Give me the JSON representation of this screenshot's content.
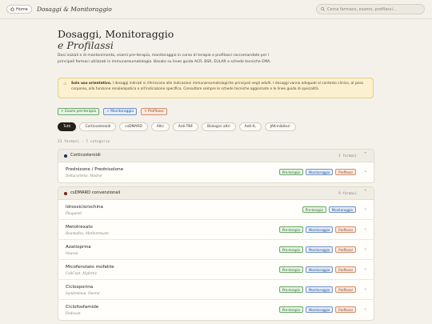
{
  "header": {
    "home_label": "Home",
    "home_icon": "house-icon",
    "title": "Dosaggi & Monitoraggio",
    "search_placeholder": "Cerca farmaco, esame, profilassi…",
    "search_icon": "search-icon"
  },
  "page": {
    "title": "Dosaggi, Monitoraggio",
    "subtitle": "e Profilassi",
    "intro": "Dosi iniziali e di mantenimento, esami pre-terapia, monitoraggio in corso di terapia e profilassi raccomandate per i principali farmaci utilizzati in immunoreumatologia. Basato su linee guida ACR, BSR, EULAR e schede tecniche EMA."
  },
  "alert": {
    "icon": "warning-icon",
    "bold": "Solo uso orientativo.",
    "text": " I dosaggi indicati si riferiscono alle indicazioni immunoreumatologiche principali negli adulti. I dosaggi vanno adeguati al contesto clinico, al peso corporeo, alla funzione renale/epatica e all'indicazione specifica. Consultare sempre le schede tecniche aggiornate e le linee guida di specialità."
  },
  "legend": {
    "pre": "+ Esami pre-terapia",
    "mon": "+ Monitoraggio",
    "pro": "+ Profilassi"
  },
  "filters": [
    "Tutti",
    "Corticosteroidi",
    "csDMARD",
    "Altri",
    "Anti-TNF",
    "Biologici altri",
    "Anti-IL",
    "JAK-inibitori"
  ],
  "counts": "33 farmaci · 7 categorie",
  "tag_labels": {
    "pre": "Pre-terapia",
    "mon": "Monitoraggio",
    "pro": "Profilassi"
  },
  "colors": {
    "pre_bg": "#e7f3e6",
    "pre_border": "#6ea86b",
    "pre_text": "#2f6a2d",
    "mon_bg": "#e6eef9",
    "mon_border": "#6f93c9",
    "mon_text": "#294f8a",
    "pro_bg": "#fbe9df",
    "pro_border": "#d38f6d",
    "pro_text": "#8a4325"
  },
  "categories": [
    {
      "name": "Corticosteroidi",
      "count": "1 farmaci",
      "dot_color": "#1f3566",
      "drugs": [
        {
          "name": "Prednisone / Prednisolone",
          "brand": "Deltacortene, Medrol",
          "tags": [
            "pre",
            "mon",
            "pro"
          ]
        }
      ]
    },
    {
      "name": "csDMARD convenzionali",
      "count": "9 farmaci",
      "dot_color": "#7a2a20",
      "drugs": [
        {
          "name": "Idrossiclorochina",
          "brand": "Plaquenil",
          "tags": [
            "pre",
            "mon"
          ]
        },
        {
          "name": "Metotrexato",
          "brand": "Reumaflex, Methotrexate",
          "tags": [
            "pre",
            "mon",
            "pro"
          ]
        },
        {
          "name": "Azatioprina",
          "brand": "Imuran",
          "tags": [
            "pre",
            "mon",
            "pro"
          ]
        },
        {
          "name": "Micofenolato mofetile",
          "brand": "CellCept, Myfortic",
          "tags": [
            "pre",
            "mon",
            "pro"
          ]
        },
        {
          "name": "Ciclosporina",
          "brand": "Sandimmun, Neoral",
          "tags": [
            "pre",
            "mon",
            "pro"
          ]
        },
        {
          "name": "Ciclofosfamide",
          "brand": "Endoxan",
          "tags": [
            "pre",
            "mon",
            "pro"
          ]
        }
      ]
    }
  ],
  "chevron_icon": "chevron-down-icon"
}
